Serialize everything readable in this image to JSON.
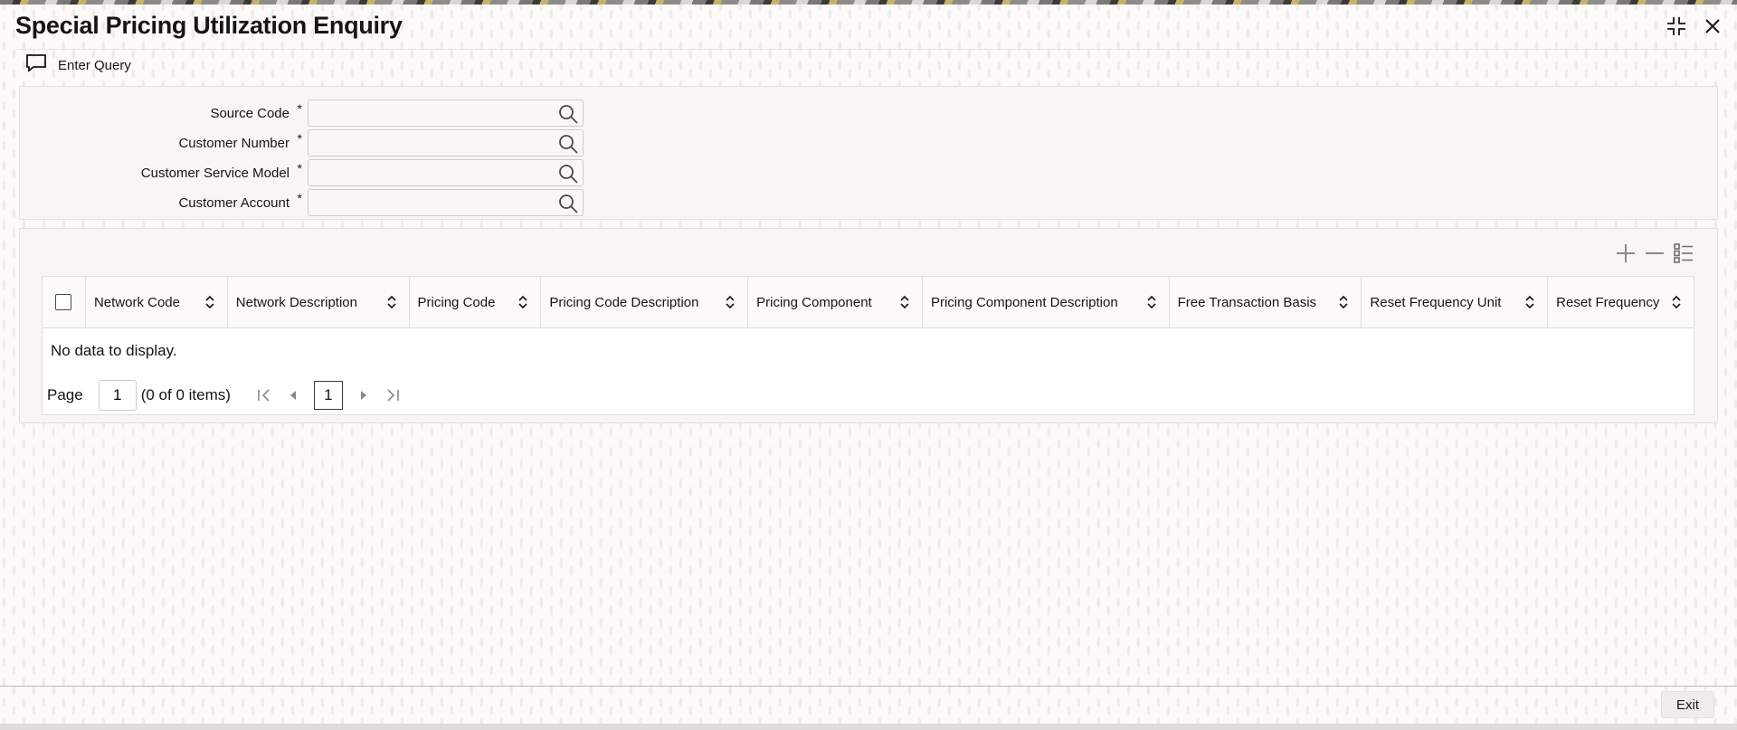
{
  "window": {
    "title": "Special Pricing Utilization Enquiry"
  },
  "toolbar": {
    "enter_query_label": "Enter Query"
  },
  "query_form": {
    "fields": [
      {
        "label": "Source Code",
        "required_mark": "*",
        "value": ""
      },
      {
        "label": "Customer Number",
        "required_mark": "*",
        "value": ""
      },
      {
        "label": "Customer Service Model",
        "required_mark": "*",
        "value": ""
      },
      {
        "label": "Customer Account",
        "required_mark": "*",
        "value": ""
      }
    ]
  },
  "grid": {
    "columns": [
      "Network Code",
      "Network Description",
      "Pricing Code",
      "Pricing Code Description",
      "Pricing Component",
      "Pricing Component Description",
      "Free Transaction Basis",
      "Reset Frequency Unit",
      "Reset Frequency"
    ],
    "empty_message": "No data to display.",
    "pager": {
      "page_label": "Page",
      "page_value": "1",
      "items_text": "(0 of 0 items)",
      "current_page": "1"
    },
    "tools": [
      "add-row-icon",
      "remove-row-icon",
      "column-list-icon"
    ]
  },
  "footer": {
    "exit_label": "Exit"
  },
  "colors": {
    "text": "#161513",
    "panel_bg": "#f7f6f4",
    "border": "#e2e0dc"
  }
}
